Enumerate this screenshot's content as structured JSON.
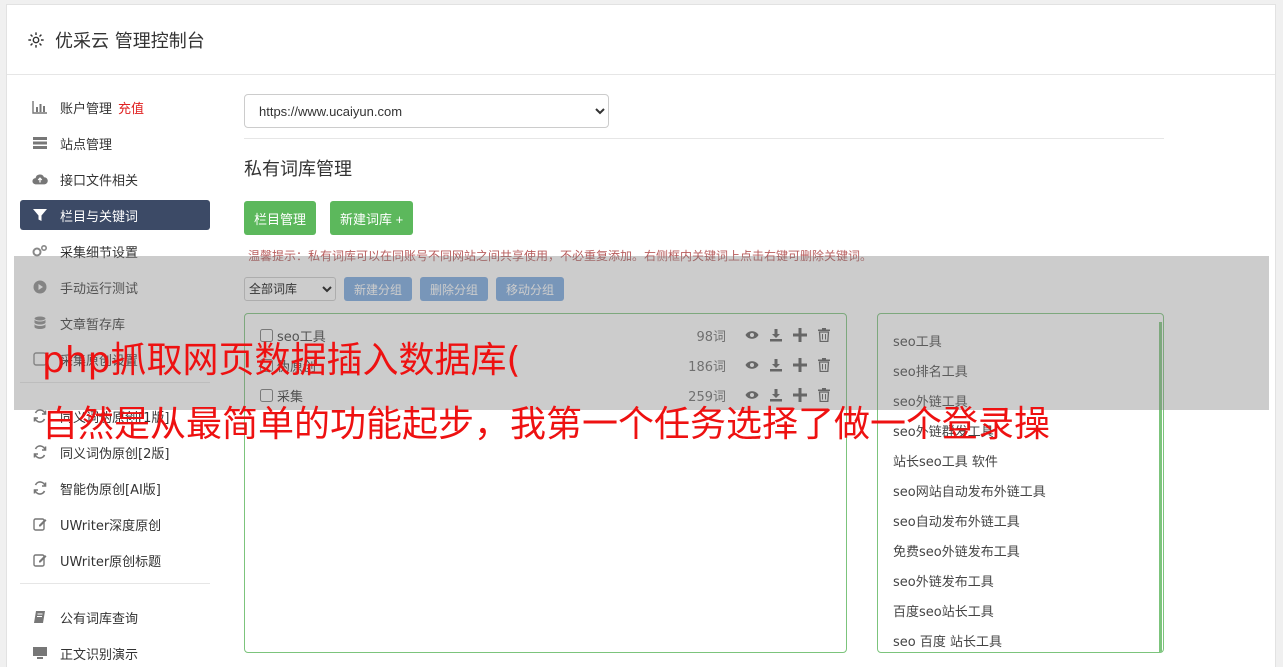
{
  "header": {
    "title": "优采云 管理控制台",
    "icon": "gear-icon"
  },
  "sidebar": {
    "items": [
      {
        "label": "账户管理",
        "badge": "充值",
        "icon": "bar-chart-icon"
      },
      {
        "label": "站点管理",
        "icon": "server-icon"
      },
      {
        "label": "接口文件相关",
        "icon": "cloud-upload-icon"
      },
      {
        "label": "栏目与关键词",
        "icon": "filter-icon",
        "active": true
      },
      {
        "label": "采集细节设置",
        "icon": "cogs-icon"
      },
      {
        "label": "手动运行测试",
        "icon": "play-circle-icon"
      },
      {
        "label": "文章暂存库",
        "icon": "database-icon"
      },
      {
        "label": "采集原创设置",
        "icon": "square-icon"
      }
    ],
    "items2": [
      {
        "label": "同义词伪原创[1版]",
        "icon": "refresh-icon"
      },
      {
        "label": "同义词伪原创[2版]",
        "icon": "refresh-icon"
      },
      {
        "label": "智能伪原创[AI版]",
        "icon": "refresh-icon"
      },
      {
        "label": "UWriter深度原创",
        "icon": "edit-icon"
      },
      {
        "label": "UWriter原创标题",
        "icon": "edit-icon"
      }
    ],
    "items3": [
      {
        "label": "公有词库查询",
        "icon": "book-icon"
      },
      {
        "label": "正文识别演示",
        "icon": "monitor-icon"
      }
    ]
  },
  "main": {
    "site_select": "https://www.ucaiyun.com",
    "section_title": "私有词库管理",
    "btn_columns": "栏目管理",
    "btn_new_lib": "新建词库 +",
    "tip": "温馨提示：私有词库可以在同账号不同网站之间共享使用，不必重复添加。右侧框内关键词上点击右键可删除关键词。",
    "group_select": "全部词库",
    "btn_new_group": "新建分组",
    "btn_del_group": "删除分组",
    "btn_move_group": "移动分组",
    "libraries": [
      {
        "name": "seo工具",
        "count": "98词"
      },
      {
        "name": "伪原创",
        "count": "186词"
      },
      {
        "name": "采集",
        "count": "259词"
      }
    ],
    "keywords": [
      "seo工具",
      "seo排名工具",
      "seo外链工具",
      "seo外链群发工具",
      "站长seo工具 软件",
      "seo网站自动发布外链工具",
      "seo自动发布外链工具",
      "免费seo外链发布工具",
      "seo外链发布工具",
      "百度seo站长工具",
      "seo 百度 站长工具"
    ]
  },
  "overlay": {
    "line1": "php抓取网页数据插入数据库(",
    "line2": "自然是从最简单的功能起步，我第一个任务选择了做一个登录操"
  },
  "colors": {
    "active_nav": "#3c4a66",
    "green": "#5cb85c",
    "blue": "#74a6e0",
    "overlay_red": "#ee1111"
  }
}
